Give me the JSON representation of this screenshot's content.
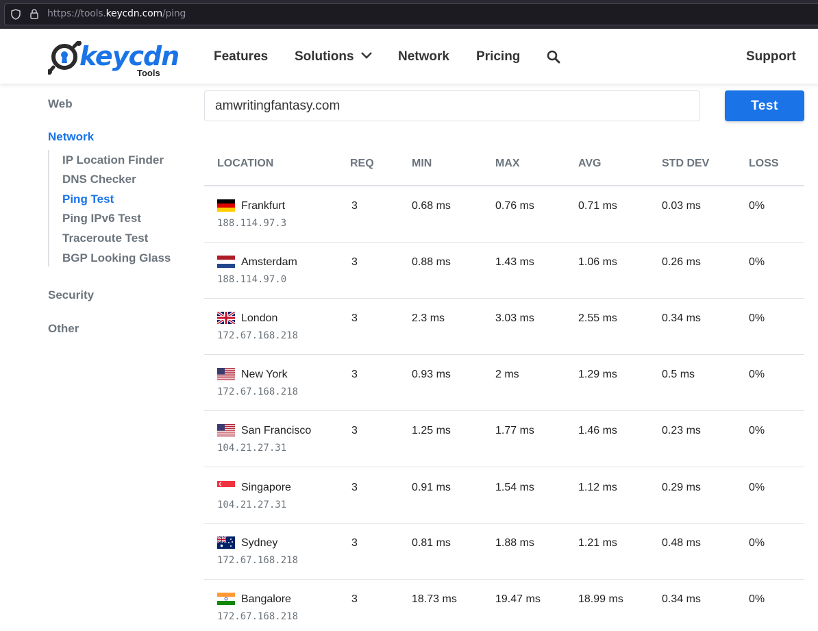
{
  "browser": {
    "url_prefix": "https://tools.",
    "url_host": "keycdn.com",
    "url_path": "/ping"
  },
  "header": {
    "logo_text": "keycdn",
    "logo_sub": "Tools",
    "nav": [
      "Features",
      "Solutions",
      "Network",
      "Pricing"
    ],
    "support": "Support"
  },
  "sidebar": {
    "web": "Web",
    "network": "Network",
    "links": [
      "IP Location Finder",
      "DNS Checker",
      "Ping Test",
      "Ping IPv6 Test",
      "Traceroute Test",
      "BGP Looking Glass"
    ],
    "active_link": "Ping Test",
    "security": "Security",
    "other": "Other"
  },
  "form": {
    "host_value": "amwritingfantasy.com",
    "button": "Test"
  },
  "table": {
    "headers": [
      "LOCATION",
      "REQ",
      "MIN",
      "MAX",
      "AVG",
      "STD DEV",
      "LOSS"
    ],
    "rows": [
      {
        "flag": "de",
        "city": "Frankfurt",
        "ip": "188.114.97.3",
        "req": "3",
        "min": "0.68 ms",
        "max": "0.76 ms",
        "avg": "0.71 ms",
        "std": "0.03 ms",
        "loss": "0%"
      },
      {
        "flag": "nl",
        "city": "Amsterdam",
        "ip": "188.114.97.0",
        "req": "3",
        "min": "0.88 ms",
        "max": "1.43 ms",
        "avg": "1.06 ms",
        "std": "0.26 ms",
        "loss": "0%"
      },
      {
        "flag": "gb",
        "city": "London",
        "ip": "172.67.168.218",
        "req": "3",
        "min": "2.3 ms",
        "max": "3.03 ms",
        "avg": "2.55 ms",
        "std": "0.34 ms",
        "loss": "0%"
      },
      {
        "flag": "us",
        "city": "New York",
        "ip": "172.67.168.218",
        "req": "3",
        "min": "0.93 ms",
        "max": "2 ms",
        "avg": "1.29 ms",
        "std": "0.5 ms",
        "loss": "0%"
      },
      {
        "flag": "us",
        "city": "San Francisco",
        "ip": "104.21.27.31",
        "req": "3",
        "min": "1.25 ms",
        "max": "1.77 ms",
        "avg": "1.46 ms",
        "std": "0.23 ms",
        "loss": "0%"
      },
      {
        "flag": "sg",
        "city": "Singapore",
        "ip": "104.21.27.31",
        "req": "3",
        "min": "0.91 ms",
        "max": "1.54 ms",
        "avg": "1.12 ms",
        "std": "0.29 ms",
        "loss": "0%"
      },
      {
        "flag": "au",
        "city": "Sydney",
        "ip": "172.67.168.218",
        "req": "3",
        "min": "0.81 ms",
        "max": "1.88 ms",
        "avg": "1.21 ms",
        "std": "0.48 ms",
        "loss": "0%"
      },
      {
        "flag": "in",
        "city": "Bangalore",
        "ip": "172.67.168.218",
        "req": "3",
        "min": "18.73 ms",
        "max": "19.47 ms",
        "avg": "18.99 ms",
        "std": "0.34 ms",
        "loss": "0%"
      }
    ]
  },
  "colors": {
    "accent": "#1a74e8",
    "muted": "#6c757d",
    "rule": "#dee2e6"
  }
}
